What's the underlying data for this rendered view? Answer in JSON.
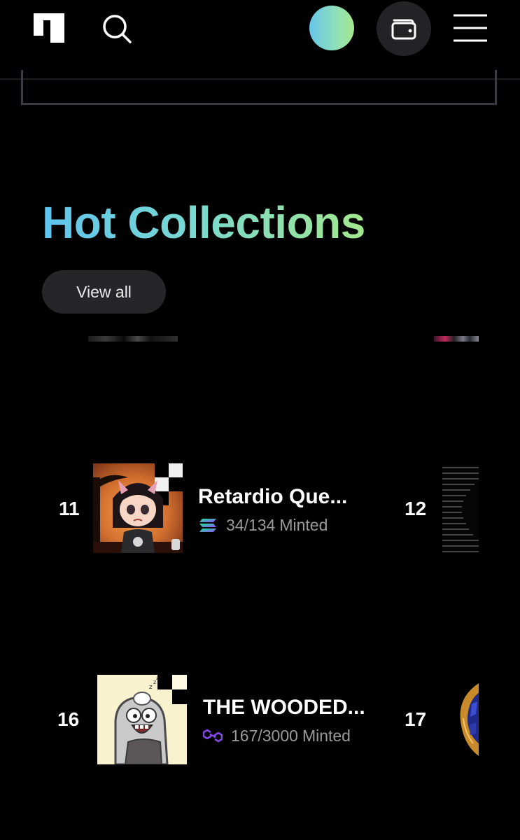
{
  "header": {
    "logo_icon": "platform-logo-icon",
    "search_icon": "search-icon",
    "avatar_gradient": [
      "#66c6ea",
      "#a6e88c"
    ],
    "wallet_icon": "wallet-icon",
    "menu_icon": "hamburger-menu-icon"
  },
  "section": {
    "title": "Hot Collections",
    "view_all_label": "View all"
  },
  "collections": [
    {
      "rank": "11",
      "name": "Retardio Que...",
      "chain_icon": "solana-icon",
      "minted": "34/134",
      "minted_label": "Minted"
    },
    {
      "rank": "12",
      "name": "",
      "chain_icon": "",
      "minted": "",
      "minted_label": ""
    },
    {
      "rank": "16",
      "name": "THE WOODED...",
      "chain_icon": "polygon-icon",
      "minted": "167/3000",
      "minted_label": "Minted"
    },
    {
      "rank": "17",
      "name": "",
      "chain_icon": "",
      "minted": "",
      "minted_label": ""
    }
  ],
  "colors": {
    "background": "#000000",
    "button_bg": "#262629",
    "muted_text": "#9a9a9a",
    "title_gradient_start": "#5fc4ef",
    "title_gradient_end": "#a3e88e",
    "solana_purple": "#9945ff",
    "solana_green": "#14f195",
    "polygon_purple": "#8247e5"
  }
}
